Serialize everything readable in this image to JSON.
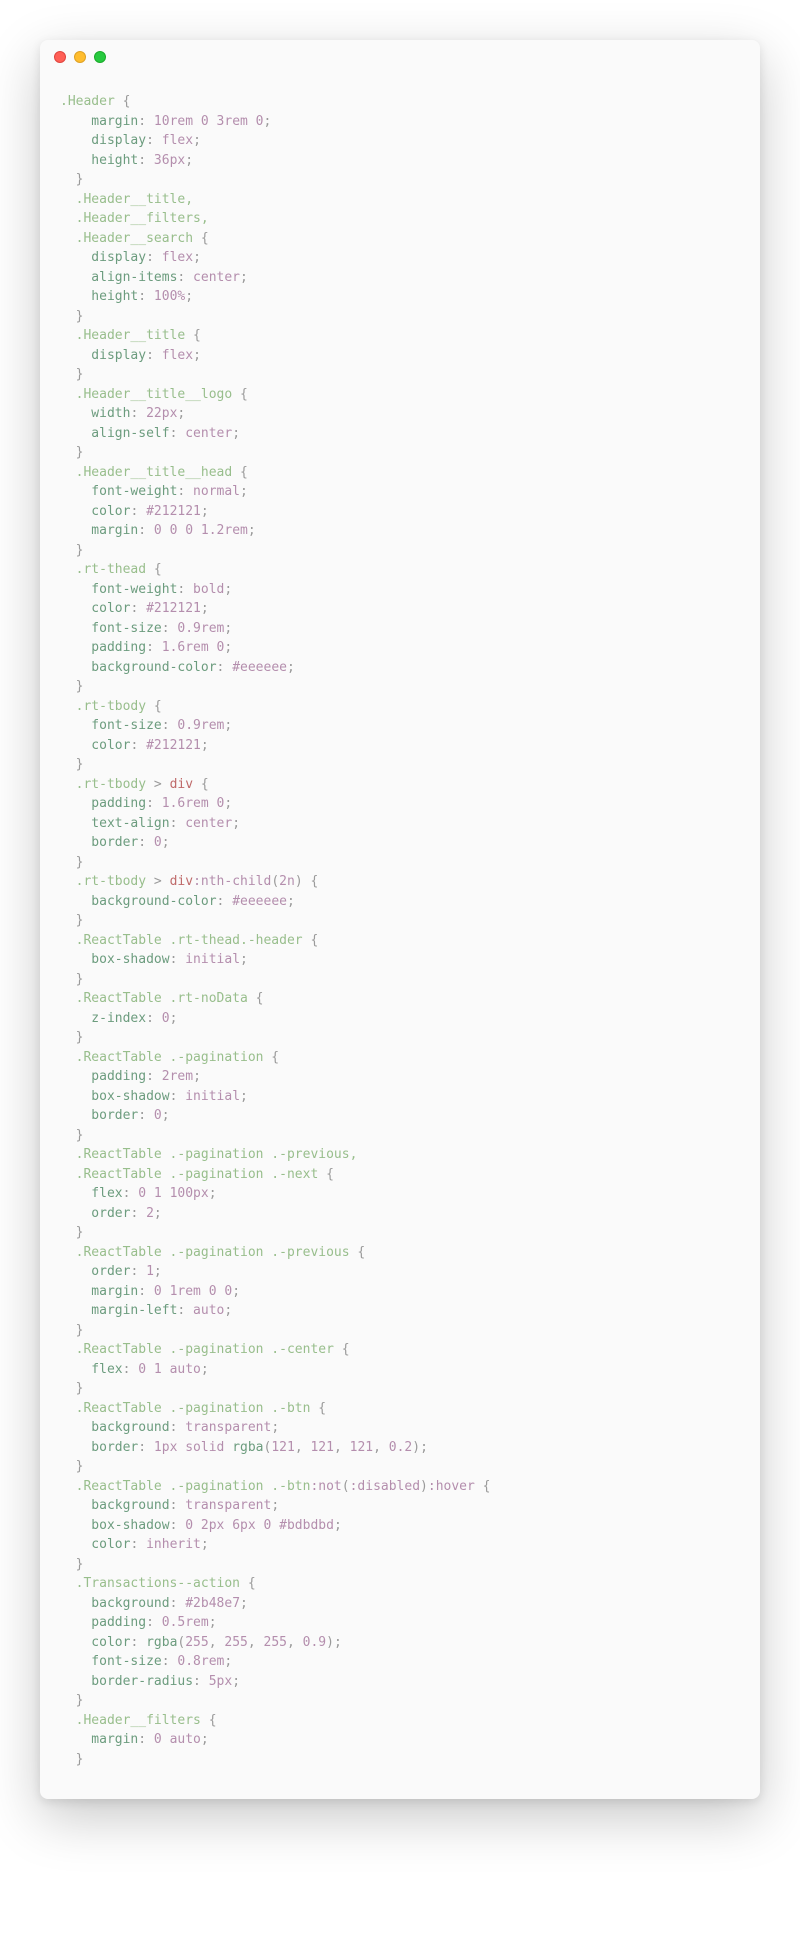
{
  "code": {
    "rules": [
      {
        "selectors": [
          ".Header"
        ],
        "decls": [
          {
            "prop": "margin",
            "value": "10rem 0 3rem 0",
            "type": "num"
          },
          {
            "prop": "display",
            "value": "flex",
            "type": "kw"
          },
          {
            "prop": "height",
            "value": "36px",
            "type": "num"
          }
        ]
      },
      {
        "selectors": [
          ".Header__title,",
          ".Header__filters,",
          ".Header__search"
        ],
        "decls": [
          {
            "prop": "display",
            "value": "flex",
            "type": "kw"
          },
          {
            "prop": "align-items",
            "value": "center",
            "type": "kw"
          },
          {
            "prop": "height",
            "value": "100%",
            "type": "num"
          }
        ]
      },
      {
        "selectors": [
          ".Header__title"
        ],
        "decls": [
          {
            "prop": "display",
            "value": "flex",
            "type": "kw"
          }
        ]
      },
      {
        "selectors": [
          ".Header__title__logo"
        ],
        "decls": [
          {
            "prop": "width",
            "value": "22px",
            "type": "num"
          },
          {
            "prop": "align-self",
            "value": "center",
            "type": "kw"
          }
        ]
      },
      {
        "selectors": [
          ".Header__title__head"
        ],
        "decls": [
          {
            "prop": "font-weight",
            "value": "normal",
            "type": "kw"
          },
          {
            "prop": "color",
            "value": "#212121",
            "type": "hex"
          },
          {
            "prop": "margin",
            "value": "0 0 0 1.2rem",
            "type": "num"
          }
        ]
      },
      {
        "blank": true
      },
      {
        "selectors": [
          ".rt-thead"
        ],
        "decls": [
          {
            "prop": "font-weight",
            "value": "bold",
            "type": "kw"
          },
          {
            "prop": "color",
            "value": "#212121",
            "type": "hex"
          },
          {
            "prop": "font-size",
            "value": "0.9rem",
            "type": "num"
          },
          {
            "prop": "padding",
            "value": "1.6rem 0",
            "type": "num"
          },
          {
            "prop": "background-color",
            "value": "#eeeeee",
            "type": "hex"
          }
        ]
      },
      {
        "selectors": [
          ".rt-tbody"
        ],
        "decls": [
          {
            "prop": "font-size",
            "value": "0.9rem",
            "type": "num"
          },
          {
            "prop": "color",
            "value": "#212121",
            "type": "hex"
          }
        ]
      },
      {
        "selectors_complex": [
          [
            {
              "t": "sel",
              "v": ".rt-tbody"
            },
            {
              "t": "punc",
              "v": " > "
            },
            {
              "t": "tag",
              "v": "div"
            }
          ]
        ],
        "decls": [
          {
            "prop": "padding",
            "value": "1.6rem 0",
            "type": "num"
          },
          {
            "prop": "text-align",
            "value": "center",
            "type": "kw"
          },
          {
            "prop": "border",
            "value": "0",
            "type": "num"
          }
        ]
      },
      {
        "selectors_complex": [
          [
            {
              "t": "sel",
              "v": ".rt-tbody"
            },
            {
              "t": "punc",
              "v": " > "
            },
            {
              "t": "tag",
              "v": "div"
            },
            {
              "t": "pseudo",
              "v": ":nth-child"
            },
            {
              "t": "punc",
              "v": "("
            },
            {
              "t": "num",
              "v": "2n"
            },
            {
              "t": "punc",
              "v": ")"
            }
          ]
        ],
        "decls": [
          {
            "prop": "background-color",
            "value": "#eeeeee",
            "type": "hex"
          }
        ]
      },
      {
        "blank": true
      },
      {
        "selectors": [
          ".ReactTable .rt-thead.-header"
        ],
        "decls": [
          {
            "prop": "box-shadow",
            "value": "initial",
            "type": "kw"
          }
        ]
      },
      {
        "blank": true
      },
      {
        "selectors": [
          ".ReactTable .rt-noData"
        ],
        "decls": [
          {
            "prop": "z-index",
            "value": "0",
            "type": "num"
          }
        ]
      },
      {
        "blank": true
      },
      {
        "selectors": [
          ".ReactTable .-pagination"
        ],
        "decls": [
          {
            "prop": "padding",
            "value": "2rem",
            "type": "num"
          },
          {
            "prop": "box-shadow",
            "value": "initial",
            "type": "kw"
          },
          {
            "prop": "border",
            "value": "0",
            "type": "num"
          }
        ]
      },
      {
        "selectors": [
          ".ReactTable .-pagination .-previous,",
          ".ReactTable .-pagination .-next"
        ],
        "decls": [
          {
            "prop": "flex",
            "value": "0 1 100px",
            "type": "num"
          },
          {
            "prop": "order",
            "value": "2",
            "type": "num"
          }
        ]
      },
      {
        "selectors": [
          ".ReactTable .-pagination .-previous"
        ],
        "decls": [
          {
            "prop": "order",
            "value": "1",
            "type": "num"
          },
          {
            "prop": "margin",
            "value": "0 1rem 0 0",
            "type": "num"
          },
          {
            "prop": "margin-left",
            "value": "auto",
            "type": "kw"
          }
        ]
      },
      {
        "selectors": [
          ".ReactTable .-pagination .-center"
        ],
        "decls": [
          {
            "prop": "flex",
            "value": "0 1 auto",
            "type": "num"
          }
        ]
      },
      {
        "blank": true
      },
      {
        "selectors": [
          ".ReactTable .-pagination .-btn"
        ],
        "decls": [
          {
            "prop": "background",
            "value": "transparent",
            "type": "kw"
          },
          {
            "prop": "border",
            "value_complex": [
              {
                "t": "num",
                "v": "1px "
              },
              {
                "t": "kw",
                "v": "solid "
              },
              {
                "t": "fun",
                "v": "rgba"
              },
              {
                "t": "punc",
                "v": "("
              },
              {
                "t": "num",
                "v": "121"
              },
              {
                "t": "punc",
                "v": ", "
              },
              {
                "t": "num",
                "v": "121"
              },
              {
                "t": "punc",
                "v": ", "
              },
              {
                "t": "num",
                "v": "121"
              },
              {
                "t": "punc",
                "v": ", "
              },
              {
                "t": "num",
                "v": "0.2"
              },
              {
                "t": "punc",
                "v": ")"
              }
            ]
          }
        ]
      },
      {
        "selectors_complex": [
          [
            {
              "t": "sel",
              "v": ".ReactTable .-pagination .-btn"
            },
            {
              "t": "pseudo",
              "v": ":not"
            },
            {
              "t": "punc",
              "v": "("
            },
            {
              "t": "pseudo",
              "v": ":disabled"
            },
            {
              "t": "punc",
              "v": ")"
            },
            {
              "t": "pseudo",
              "v": ":hover"
            }
          ]
        ],
        "decls": [
          {
            "prop": "background",
            "value": "transparent",
            "type": "kw"
          },
          {
            "prop": "box-shadow",
            "value": "0 2px 6px 0 #bdbdbd",
            "type": "num"
          },
          {
            "prop": "color",
            "value": "inherit",
            "type": "kw"
          }
        ]
      },
      {
        "blank": true
      },
      {
        "selectors": [
          ".Transactions--action"
        ],
        "decls": [
          {
            "prop": "background",
            "value": "#2b48e7",
            "type": "hex"
          },
          {
            "prop": "padding",
            "value": "0.5rem",
            "type": "num"
          },
          {
            "prop": "color",
            "value_complex": [
              {
                "t": "fun",
                "v": "rgba"
              },
              {
                "t": "punc",
                "v": "("
              },
              {
                "t": "num",
                "v": "255"
              },
              {
                "t": "punc",
                "v": ", "
              },
              {
                "t": "num",
                "v": "255"
              },
              {
                "t": "punc",
                "v": ", "
              },
              {
                "t": "num",
                "v": "255"
              },
              {
                "t": "punc",
                "v": ", "
              },
              {
                "t": "num",
                "v": "0.9"
              },
              {
                "t": "punc",
                "v": ")"
              }
            ]
          },
          {
            "prop": "font-size",
            "value": "0.8rem",
            "type": "num"
          },
          {
            "prop": "border-radius",
            "value": "5px",
            "type": "num"
          }
        ]
      },
      {
        "selectors": [
          ".Header__filters"
        ],
        "decls": [
          {
            "prop": "margin",
            "value": "0 auto",
            "type": "num"
          }
        ]
      }
    ]
  }
}
